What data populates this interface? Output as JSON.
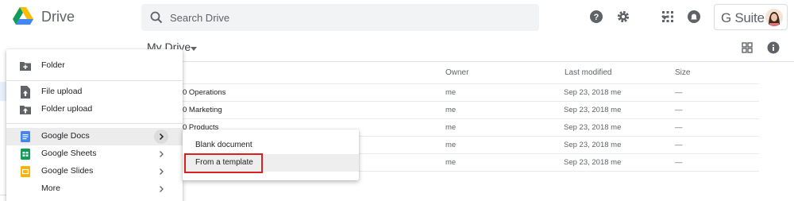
{
  "header": {
    "app_name": "Drive",
    "search_placeholder": "Search Drive",
    "gsuite_label": "G Suite"
  },
  "main": {
    "title": "My Drive",
    "columns": {
      "owner": "Owner",
      "last_modified": "Last modified",
      "size": "Size"
    },
    "rows": [
      {
        "name": "0 Operations",
        "owner": "me",
        "modified": "Sep 23, 2018 me",
        "size": "—"
      },
      {
        "name": "0 Marketing",
        "owner": "me",
        "modified": "Sep 23, 2018 me",
        "size": "—"
      },
      {
        "name": "0 Products",
        "owner": "me",
        "modified": "Sep 23, 2018 me",
        "size": "—"
      },
      {
        "name": "",
        "owner": "me",
        "modified": "Sep 23, 2018 me",
        "size": "—"
      },
      {
        "name": "",
        "owner": "me",
        "modified": "Sep 23, 2018 me",
        "size": "—"
      }
    ]
  },
  "new_menu": {
    "folder": "Folder",
    "file_upload": "File upload",
    "folder_upload": "Folder upload",
    "google_docs": "Google Docs",
    "google_sheets": "Google Sheets",
    "google_slides": "Google Slides",
    "more": "More"
  },
  "docs_submenu": {
    "blank_document": "Blank document",
    "from_template": "From a template"
  },
  "colors": {
    "docs_blue": "#4285f4",
    "sheets_green": "#0f9d58",
    "slides_yellow": "#f4b400",
    "highlight_red": "#d9221f"
  }
}
